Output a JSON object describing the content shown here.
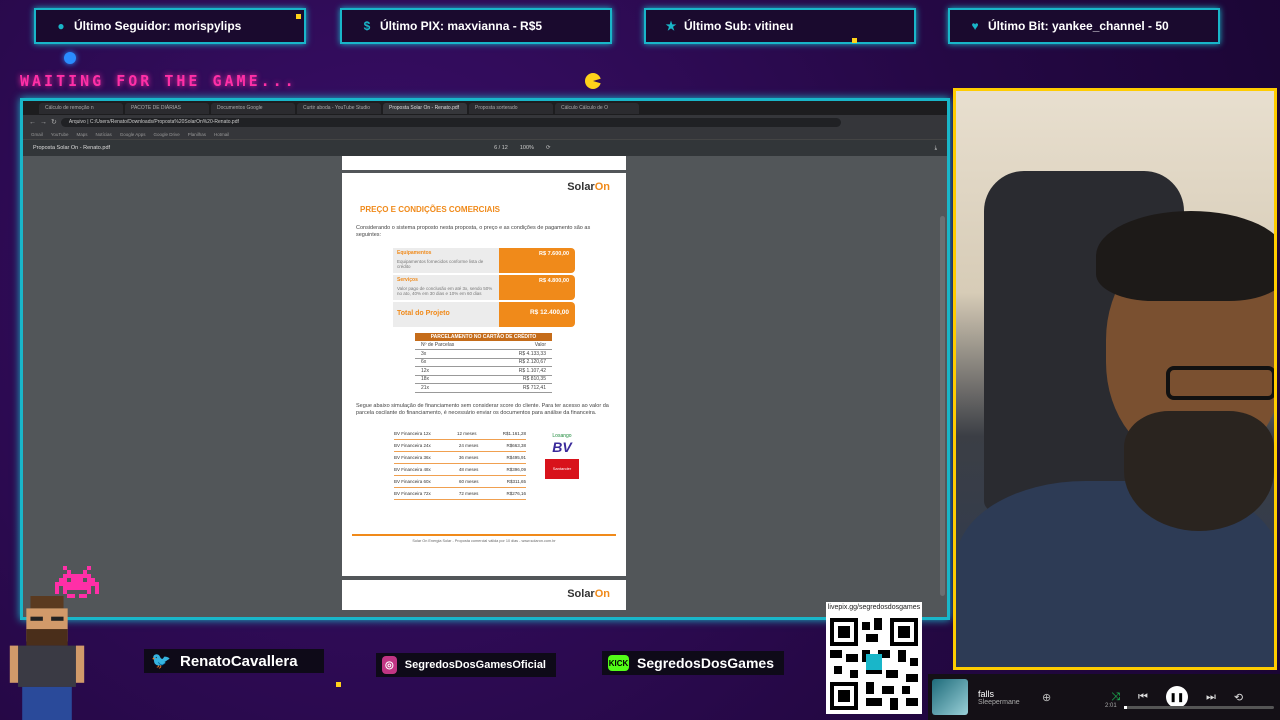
{
  "alerts": {
    "follower": "Último Seguidor: morispylips",
    "pix": "Último PIX: maxvianna - R$5",
    "sub": "Último Sub: vitineu",
    "bit": "Último Bit: yankee_channel - 50"
  },
  "overlay": {
    "waiting_text": "WAITING FOR THE GAME..."
  },
  "browser": {
    "tabs": [
      "Cálculo de remoção n",
      "PACOTE DE DIÁRIAS",
      "Documentos Google",
      "Curtir aboda - YouTube Studio",
      "Proposta Solar On - Renato.pdf",
      "Proposta sorterado",
      "Cálculo Cálculo de O"
    ],
    "url": "Arquivo | C:/Users/Renato/Downloads/Proposta%20SolarOn%20-Renato.pdf",
    "bookmarks": [
      "Gmail",
      "YouTube",
      "Maps",
      "Notícias",
      "Google Apps",
      "Google Drive",
      "Planilhas",
      "Hotmail"
    ],
    "pdf_title": "Proposta Solar On - Renato.pdf",
    "page_indicator": "6 / 12",
    "zoom": "100%"
  },
  "pdf": {
    "logo_main": "Solar",
    "logo_suffix": "On",
    "title": "PREÇO E CONDIÇÕES COMERCIAIS",
    "intro": "Considerando o sistema proposto nesta proposta, o preço e as condições de pagamento são as seguintes:",
    "items": [
      {
        "name": "Equipamentos",
        "desc": "Equipamentos fornecidos conforme lista de crédito",
        "value": "R$ 7.600,00"
      },
      {
        "name": "Serviços",
        "desc": "Valor pago de conclusão em até 3x, sendo 50% no ato, 40% em 30 dias e 10% em 60 dias",
        "value": "R$ 4.800,00"
      }
    ],
    "total_label": "Total do Projeto",
    "total_value": "R$ 12.400,00",
    "card_header": "PARCELAMENTO NO CARTÃO DE CRÉDITO",
    "card_cols": [
      "Nº de Parcelas",
      "Valor"
    ],
    "card_rows": [
      [
        "3x",
        "R$ 4.133,33"
      ],
      [
        "6x",
        "R$ 2.120,67"
      ],
      [
        "12x",
        "R$ 1.107,42"
      ],
      [
        "18x",
        "R$ 810,35"
      ],
      [
        "21x",
        "R$ 712,41"
      ]
    ],
    "financing_intro": "Segue abaixo simulação de financiamento sem considerar score do cliente. Para ter acesso ao valor da parcela oscilante do financiamento, é necessário enviar os documentos para análise da financeira.",
    "financing": [
      [
        "BV Financeira 12x",
        "12 meses",
        "R$1.161,28"
      ],
      [
        "BV Financeira 24x",
        "24 meses",
        "R$663,38"
      ],
      [
        "BV Financeira 36x",
        "36 meses",
        "R$495,91"
      ],
      [
        "BV Financeira 48x",
        "48 meses",
        "R$396,09"
      ],
      [
        "BV Financeira 60x",
        "60 meses",
        "R$311,65"
      ],
      [
        "BV Financeira 72x",
        "72 meses",
        "R$276,16"
      ]
    ],
    "banks": [
      "Losango",
      "BV",
      "Santander"
    ],
    "footer": "Solar On Energia Solar - Proposta comercial válida por 10 dias - www.solaron.com.br"
  },
  "social": {
    "twitter": "RenatoCavallera",
    "instagram": "SegredosDosGamesOficial",
    "kick": "SegredosDosGames",
    "kick_badge": "KICK",
    "qr_label": "livepix.gg/segredosdosgames"
  },
  "music": {
    "title": "falls",
    "artist": "Sleepermane",
    "time": "2:01",
    "progress": 0.02
  },
  "colors": {
    "accent": "#19b6c9",
    "pink": "#ff2fa7",
    "orange": "#f08a1a",
    "cam_border": "#ffcc00"
  }
}
